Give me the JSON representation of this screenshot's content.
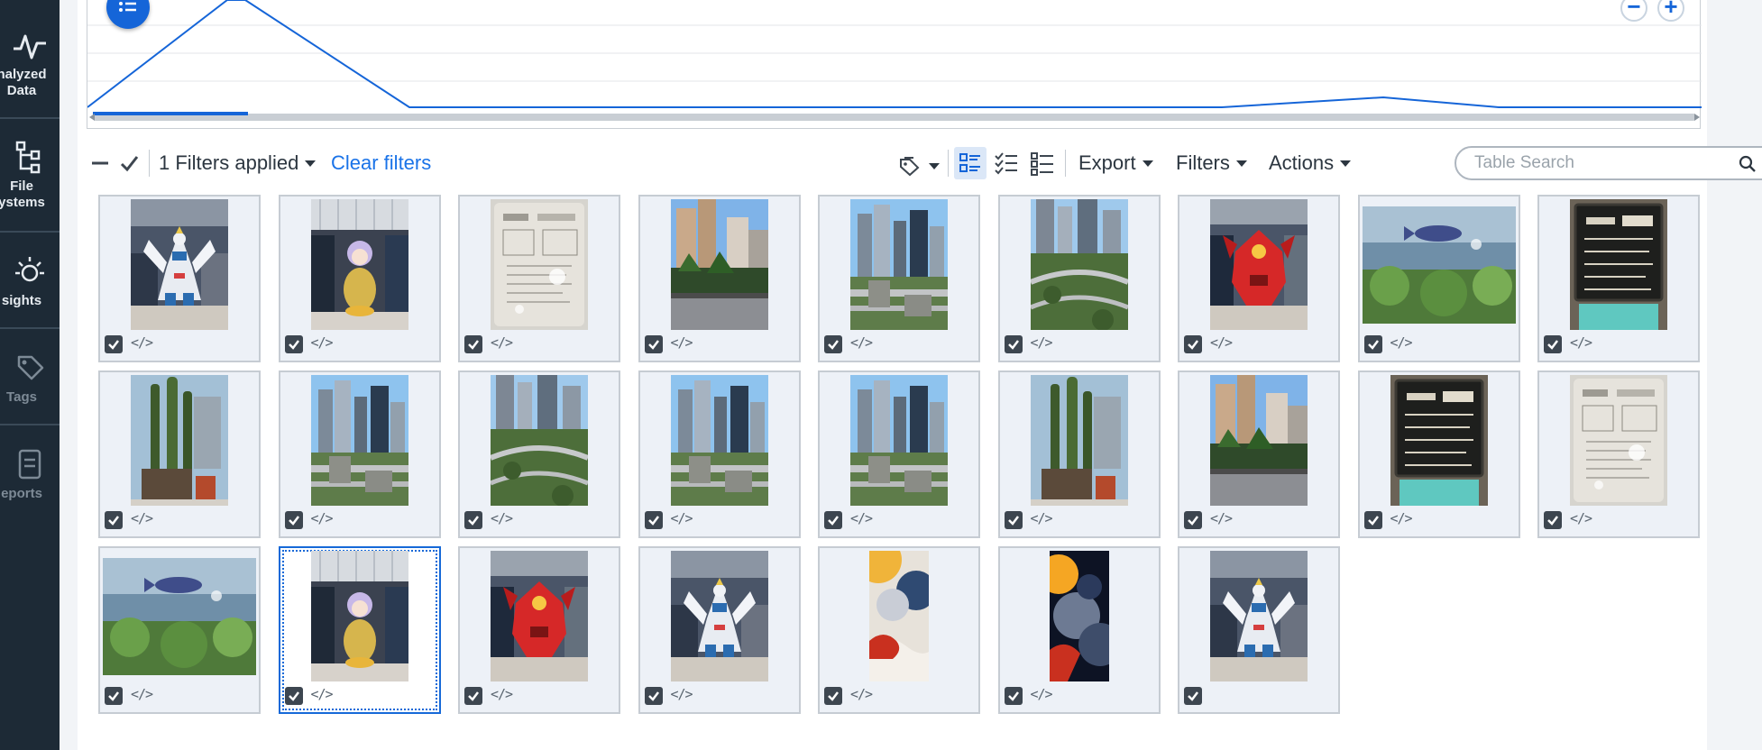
{
  "sidebar": {
    "items": [
      {
        "label_1": "nalyzed",
        "label_2": "Data",
        "icon": "activity-icon",
        "active": true
      },
      {
        "label_1": "File",
        "label_2": "ystems",
        "icon": "file-systems-icon",
        "active": true
      },
      {
        "label_1": "sights",
        "icon": "insights-icon",
        "active": true
      },
      {
        "label_1": "Tags",
        "icon": "tag-icon",
        "active": false
      },
      {
        "label_1": "eports",
        "icon": "reports-icon",
        "active": false
      }
    ]
  },
  "toolbar": {
    "filters_applied": "1 Filters applied",
    "clear_filters": "Clear filters",
    "export": "Export",
    "filters": "Filters",
    "actions": "Actions",
    "search_placeholder": "Table Search"
  },
  "colors": {
    "sidebar_bg": "#1d2a36",
    "accent": "#1565d8",
    "link": "#1a73e8",
    "card_bg": "#edf1f7"
  },
  "grid": {
    "code_glyph": "</>",
    "items": [
      {
        "kind": "gundam-white",
        "code": true
      },
      {
        "kind": "figure-yellow",
        "code": true
      },
      {
        "kind": "menu-card",
        "code": true
      },
      {
        "kind": "street-towers",
        "code": true
      },
      {
        "kind": "city-aerial",
        "code": true
      },
      {
        "kind": "city-aerial-green",
        "code": true
      },
      {
        "kind": "gundam-red",
        "code": true
      },
      {
        "kind": "aquarium",
        "code": true
      },
      {
        "kind": "chalkboard",
        "code": true
      },
      {
        "kind": "cactus",
        "code": true
      },
      {
        "kind": "city-aerial",
        "code": true
      },
      {
        "kind": "city-aerial-green",
        "code": true
      },
      {
        "kind": "city-aerial",
        "code": true
      },
      {
        "kind": "city-aerial",
        "code": true
      },
      {
        "kind": "cactus",
        "code": true
      },
      {
        "kind": "street-towers",
        "code": true
      },
      {
        "kind": "chalkboard",
        "code": true
      },
      {
        "kind": "menu-card",
        "code": true
      },
      {
        "kind": "aquarium",
        "code": true
      },
      {
        "kind": "figure-yellow",
        "code": true,
        "selected": true
      },
      {
        "kind": "gundam-red",
        "code": true
      },
      {
        "kind": "gundam-white",
        "code": true
      },
      {
        "kind": "wallpaper-light",
        "code": true
      },
      {
        "kind": "wallpaper-dark",
        "code": true
      },
      {
        "kind": "gundam-white",
        "code": false
      }
    ]
  }
}
